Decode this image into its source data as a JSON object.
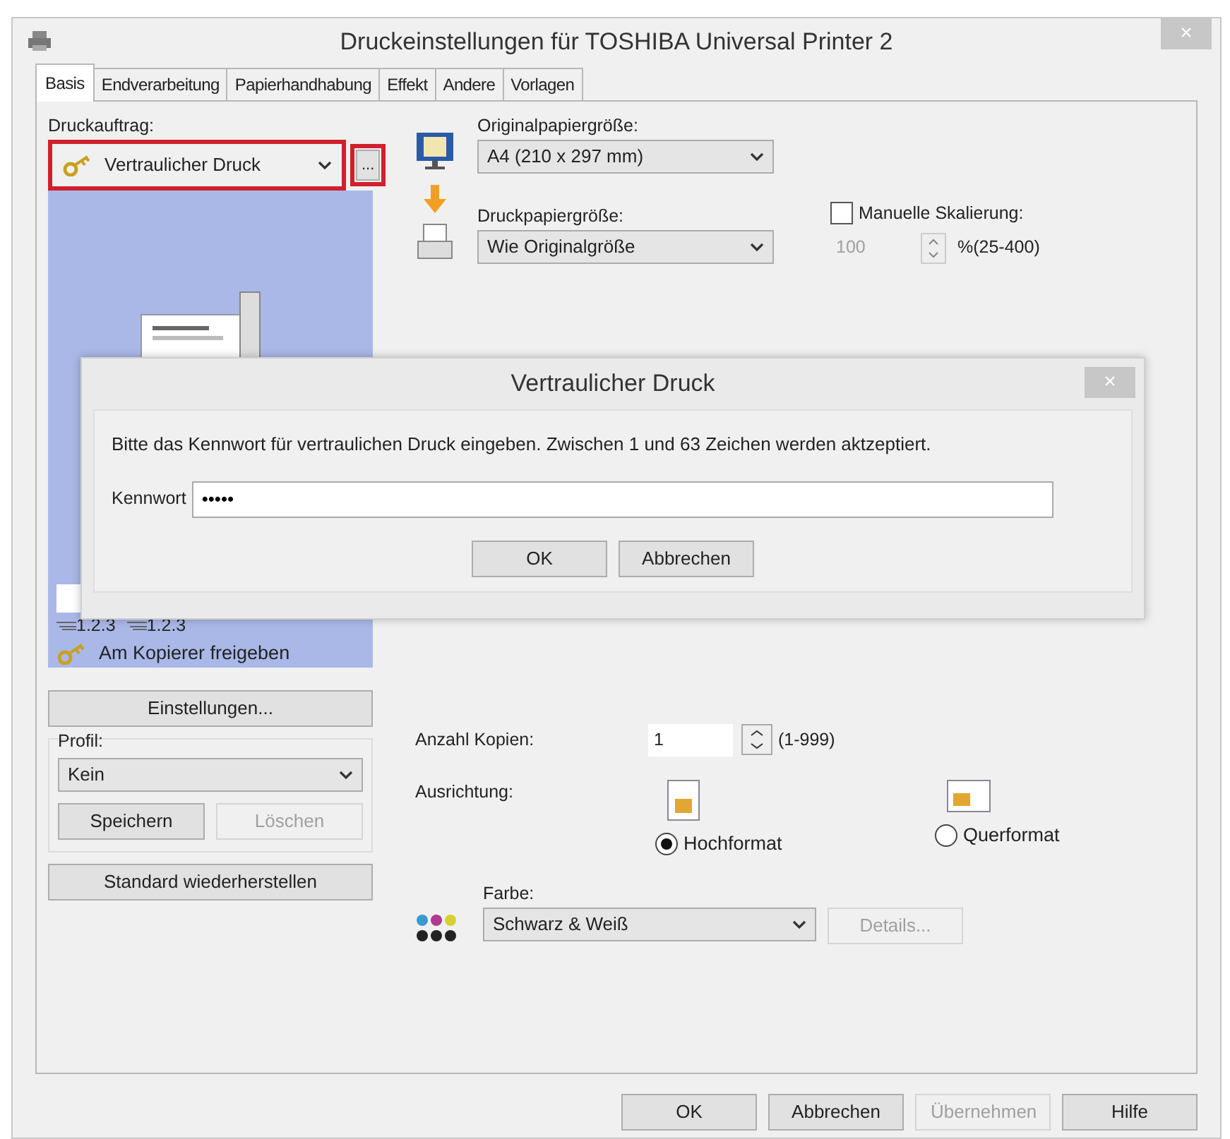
{
  "window": {
    "title": "Druckeinstellungen für TOSHIBA Universal Printer 2",
    "close": "×"
  },
  "tabs": [
    {
      "label": "Basis",
      "selected": true
    },
    {
      "label": "Endverarbeitung",
      "selected": false
    },
    {
      "label": "Papierhandhabung",
      "selected": false
    },
    {
      "label": "Effekt",
      "selected": false
    },
    {
      "label": "Andere",
      "selected": false
    },
    {
      "label": "Vorlagen",
      "selected": false
    }
  ],
  "print_job": {
    "label": "Druckauftrag:",
    "value": "Vertraulicher Druck",
    "more_button": "...",
    "highlighted": true
  },
  "preview": {
    "page_labels": [
      "1.2.3",
      "1.2.3"
    ],
    "caption": "Am Kopierer freigeben"
  },
  "settings_button": "Einstellungen...",
  "profile": {
    "label": "Profil:",
    "value": "Kein",
    "buttons": [
      {
        "label": "Speichern",
        "disabled": false
      },
      {
        "label": "Löschen",
        "disabled": true
      }
    ]
  },
  "restore_button": "Standard wiederherstellen",
  "original_size": {
    "label": "Originalpapiergröße:",
    "value": "A4 (210 x 297 mm)"
  },
  "output_size": {
    "label": "Druckpapiergröße:",
    "value": "Wie Originalgröße"
  },
  "manual_scaling": {
    "label": "Manuelle Skalierung:",
    "checked": false,
    "value": "100",
    "range": "%(25-400)"
  },
  "copies": {
    "label": "Anzahl Kopien:",
    "value": "1",
    "range": "(1-999)"
  },
  "orientation": {
    "label": "Ausrichtung:",
    "options": [
      {
        "label": "Hochformat",
        "kind": "portrait",
        "selected": true
      },
      {
        "label": "Querformat",
        "kind": "landscape",
        "selected": false
      }
    ]
  },
  "color": {
    "label": "Farbe:",
    "value": "Schwarz & Weiß",
    "details_button": {
      "label": "Details...",
      "disabled": true
    }
  },
  "footer_buttons": [
    {
      "label": "OK",
      "disabled": false
    },
    {
      "label": "Abbrechen",
      "disabled": false
    },
    {
      "label": "Übernehmen",
      "disabled": true
    },
    {
      "label": "Hilfe",
      "disabled": false
    }
  ],
  "dialog": {
    "title": "Vertraulicher Druck",
    "close": "×",
    "message": "Bitte das Kennwort für vertraulichen Druck eingeben. Zwischen 1 und 63 Zeichen werden aktzeptiert.",
    "field_label": "Kennwort",
    "field_value": "•••••",
    "buttons": [
      "OK",
      "Abbrechen"
    ]
  }
}
